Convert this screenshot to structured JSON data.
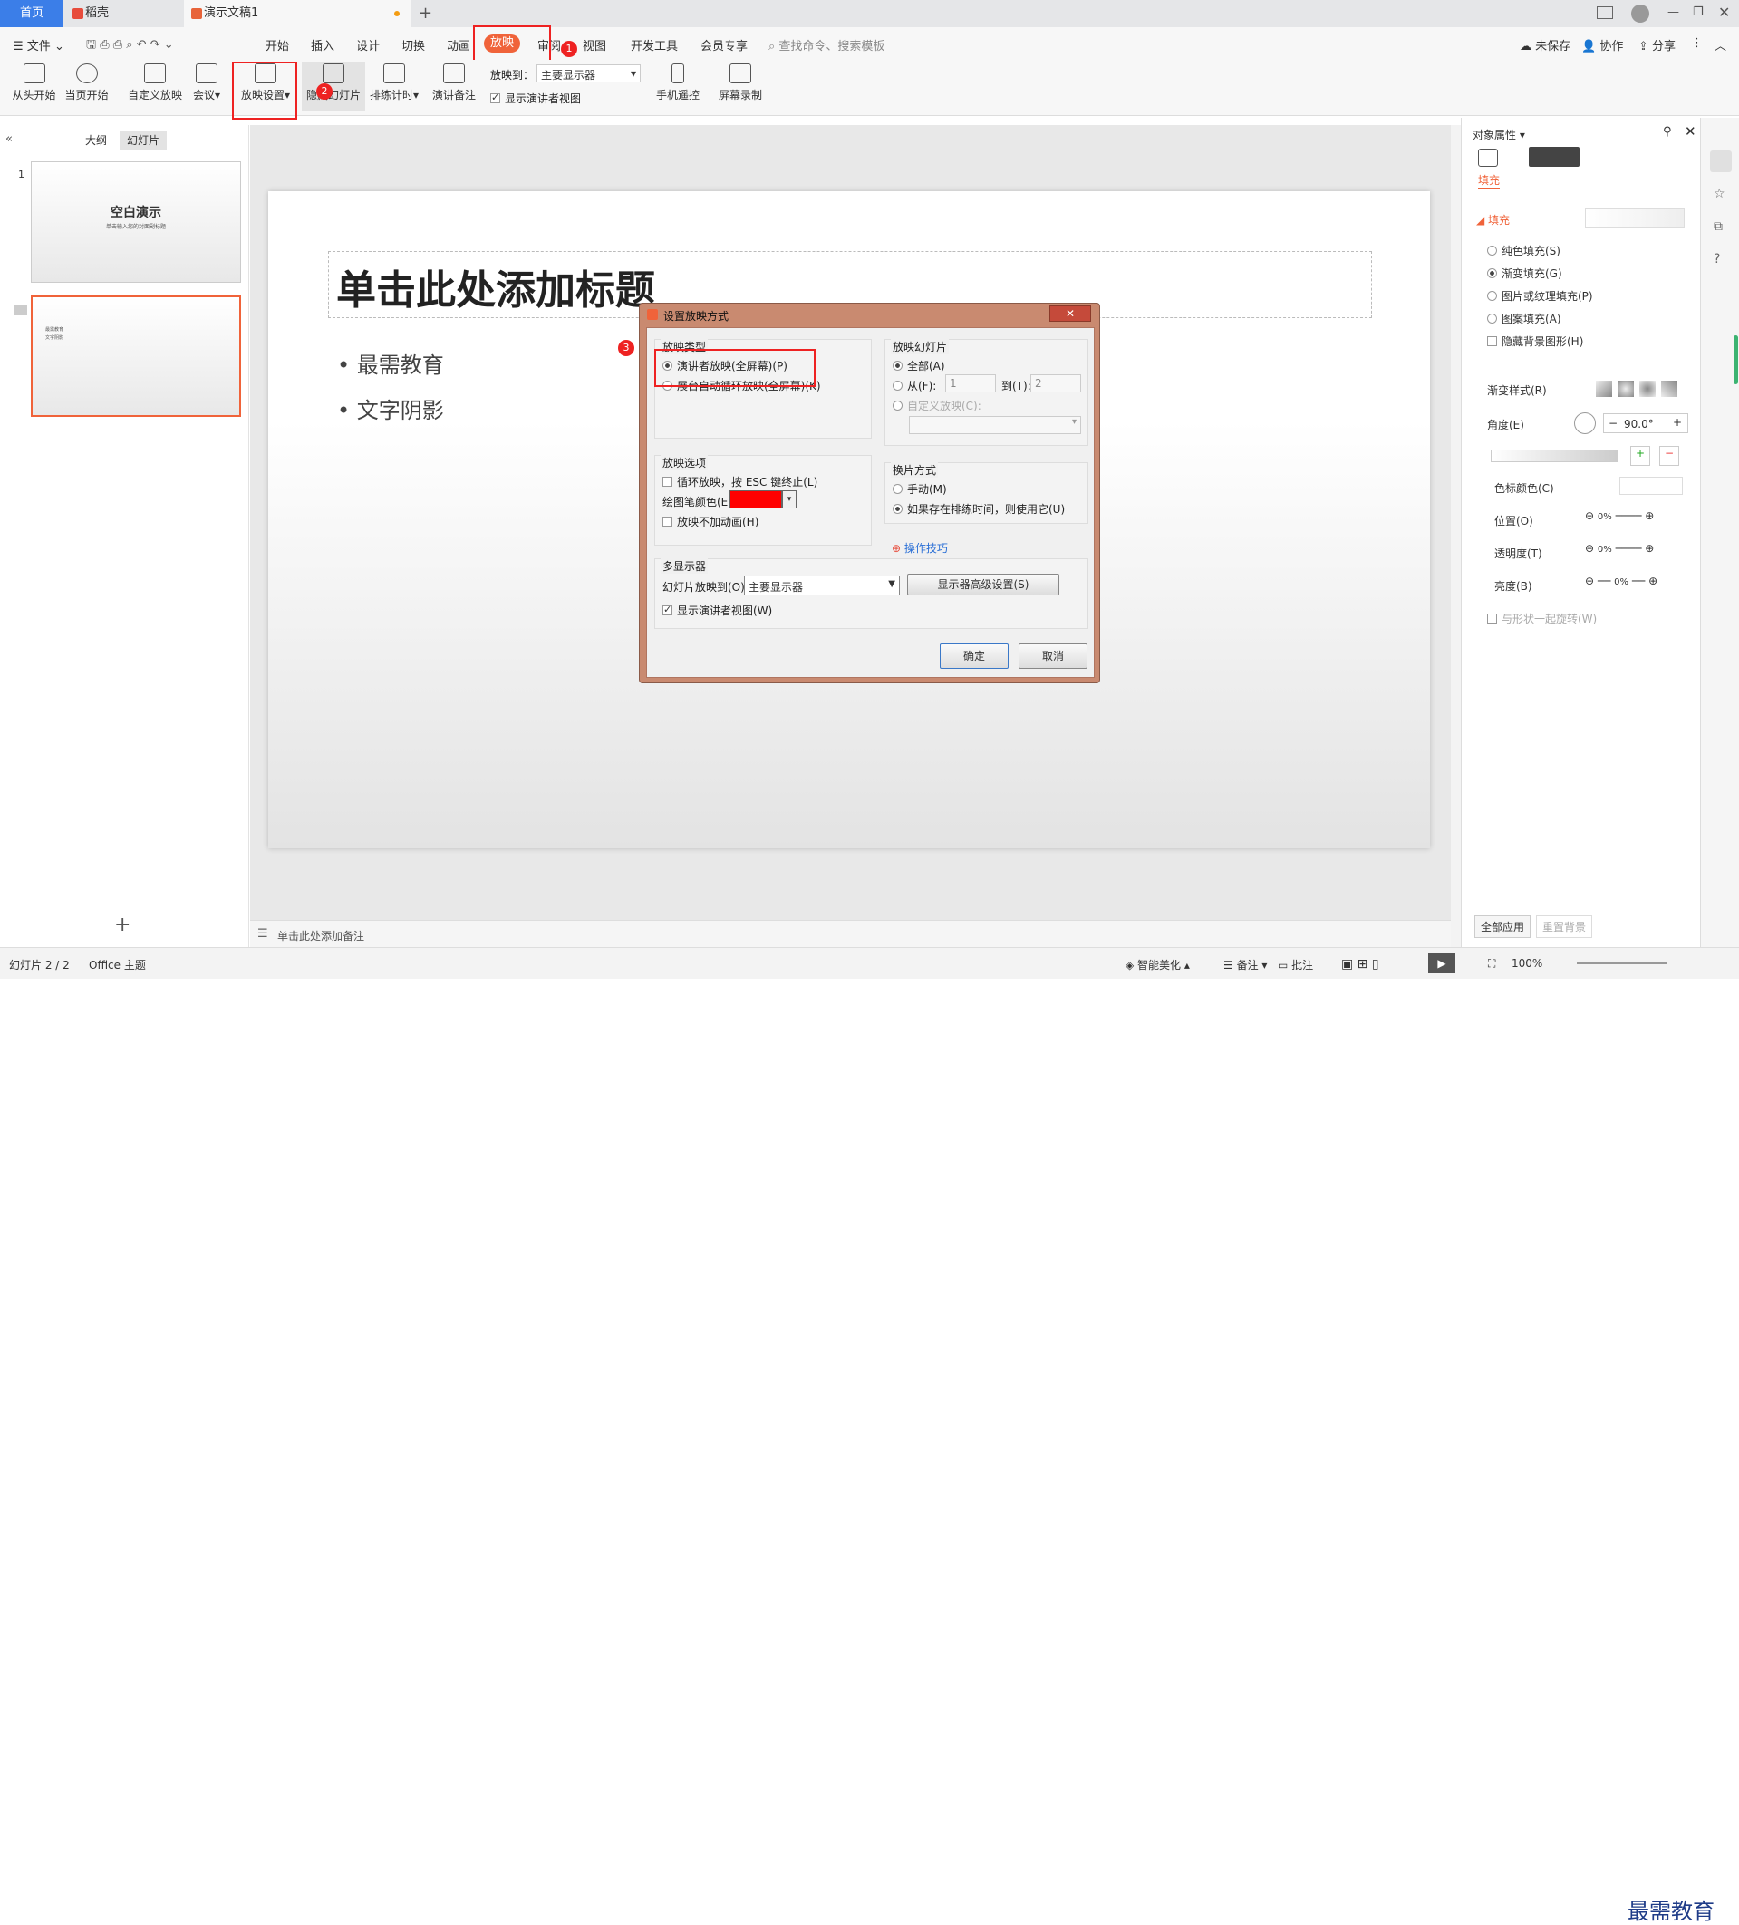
{
  "tabs": {
    "home": "首页",
    "daoke": "稻壳",
    "doc": "演示文稿1"
  },
  "menu": {
    "file": "文件",
    "items": [
      "开始",
      "插入",
      "设计",
      "切换",
      "动画",
      "放映",
      "审阅",
      "视图",
      "开发工具",
      "会员专享"
    ],
    "search": "查找命令、搜索模板",
    "unsaved": "未保存",
    "collab": "协作",
    "share": "分享"
  },
  "ribbon": {
    "from_start": "从头开始",
    "from_current": "当页开始",
    "custom": "自定义放映",
    "meeting": "会议",
    "setup": "放映设置",
    "hide": "隐藏幻灯片",
    "rehearse": "排练计时",
    "notes": "演讲备注",
    "play_to_label": "放映到：",
    "play_to_value": "主要显示器",
    "presenter_view": "显示演讲者视图",
    "phone": "手机遥控",
    "record": "屏幕录制"
  },
  "badges": [
    "1",
    "2",
    "3"
  ],
  "left": {
    "outline": "大纲",
    "slides": "幻灯片",
    "slide1_num": "1",
    "slide1_title": "空白演示",
    "slide1_sub": "单击输入您的封面副标题",
    "slide2_b1": "最需教育",
    "slide2_b2": "文字阴影"
  },
  "slide": {
    "title": "单击此处添加标题",
    "bullets": [
      "最需教育",
      "文字阴影"
    ]
  },
  "notes": "单击此处添加备注",
  "dialog": {
    "title": "设置放映方式",
    "type_group": "放映类型",
    "type_presenter": "演讲者放映(全屏幕)(P)",
    "type_kiosk": "展台自动循环放映(全屏幕)(K)",
    "slides_group": "放映幻灯片",
    "all": "全部(A)",
    "from": "从(F):",
    "from_val": "1",
    "to": "到(T):",
    "to_val": "2",
    "custom": "自定义放映(C):",
    "options_group": "放映选项",
    "loop": "循环放映，按 ESC 键终止(L)",
    "pen_color": "绘图笔颜色(E):",
    "no_anim": "放映不加动画(H)",
    "advance_group": "换片方式",
    "manual": "手动(M)",
    "timing": "如果存在排练时间，则使用它(U)",
    "tips": "操作技巧",
    "monitor_group": "多显示器",
    "play_on": "幻灯片放映到(O):",
    "play_on_val": "主要显示器",
    "monitor_adv": "显示器高级设置(S)",
    "show_presenter": "显示演讲者视图(W)",
    "ok": "确定",
    "cancel": "取消"
  },
  "props": {
    "title": "对象属性",
    "tab_fill": "填充",
    "fill_section": "填充",
    "solid": "纯色填充(S)",
    "gradient": "渐变填充(G)",
    "picture": "图片或纹理填充(P)",
    "pattern": "图案填充(A)",
    "hide_bg": "隐藏背景图形(H)",
    "grad_style": "渐变样式(R)",
    "angle": "角度(E)",
    "angle_val": "90.0°",
    "stop_color": "色标颜色(C)",
    "position": "位置(O)",
    "pos_val": "0%",
    "transparency": "透明度(T)",
    "trans_val": "0%",
    "brightness": "亮度(B)",
    "bright_val": "0%",
    "rotate": "与形状一起旋转(W)",
    "apply_all": "全部应用",
    "reset_bg": "重置背景"
  },
  "status": {
    "slide": "幻灯片 2 / 2",
    "theme": "Office 主题",
    "beautify": "智能美化",
    "notes": "备注",
    "comments": "批注",
    "zoom": "100%"
  },
  "watermark": "最需教育",
  "colors": {
    "accent": "#3b7ee8",
    "active_tab": "#f0633a",
    "pen": "#ff0000",
    "highlight": "#e22222"
  }
}
